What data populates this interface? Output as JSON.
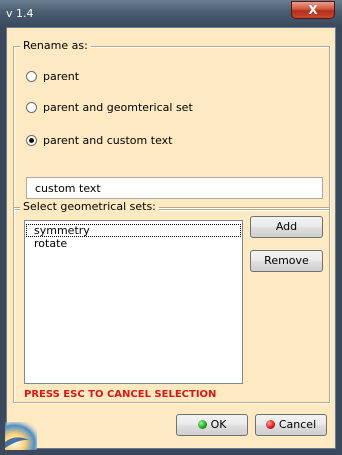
{
  "window": {
    "title": "v 1.4",
    "close_label": "X"
  },
  "rename_group": {
    "legend": "Rename as:",
    "options": [
      {
        "label": "parent",
        "checked": false
      },
      {
        "label": "parent and geomterical set",
        "checked": false
      },
      {
        "label": "parent and custom text",
        "checked": true
      }
    ],
    "custom_text_value": "custom text"
  },
  "sets_group": {
    "legend": "Select geometrical sets:",
    "items": [
      {
        "label": "symmetry"
      },
      {
        "label": "rotate"
      }
    ],
    "add_label": "Add",
    "remove_label": "Remove",
    "warning": "PRESS ESC TO CANCEL SELECTION"
  },
  "footer": {
    "ok_label": "OK",
    "cancel_label": "Cancel"
  },
  "colors": {
    "dialog_background": "#fde9c2",
    "warning_text": "#d11a1a"
  },
  "icons": {
    "ok": "green-dot-icon",
    "cancel": "red-dot-icon",
    "corner": "app-logo-icon"
  }
}
